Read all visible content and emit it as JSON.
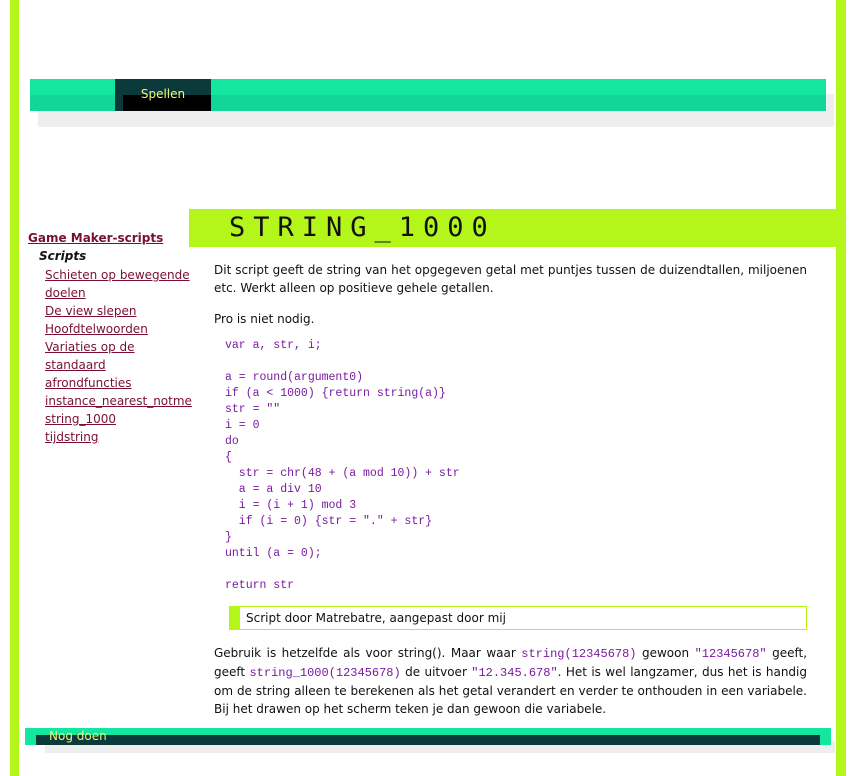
{
  "nav": {
    "tab_label": "Spellen"
  },
  "title": "STRING_1000",
  "sidebar": {
    "title": "Game Maker-scripts",
    "subtitle": "Scripts",
    "links": [
      "Schieten op bewegende doelen",
      "De view slepen",
      "Hoofdtelwoorden",
      "Variaties op de standaard",
      "afrondfuncties",
      "instance_nearest_notme",
      "string_1000",
      "tijdstring"
    ]
  },
  "content": {
    "p1": "Dit script geeft de string van het opgegeven getal met puntjes tussen de duizendtallen, miljoenen etc. Werkt alleen op positieve gehele getallen.",
    "p2": "Pro is niet nodig.",
    "code": "var a, str, i;\n\na = round(argument0)\nif (a < 1000) {return string(a)}\nstr = \"\"\ni = 0\ndo\n{\n  str = chr(48 + (a mod 10)) + str\n  a = a div 10\n  i = (i + 1) mod 3\n  if (i = 0) {str = \".\" + str}\n}\nuntil (a = 0);\n\nreturn str",
    "credit": "Script door Matrebatre, aangepast door mij",
    "p3_parts": {
      "t1": "Gebruik is hetzelfde als voor string(). Maar waar ",
      "c1": "string(12345678)",
      "t2": " gewoon ",
      "c2": "\"12345678\"",
      "t3": " geeft, geeft ",
      "c3": "string_1000(12345678)",
      "t4": " de uitvoer ",
      "c4": "\"12.345.678\"",
      "t5": ". Het is wel langzamer, dus het is handig om de string alleen te berekenen als het getal verandert en verder te onthouden in een variabele. Bij het drawen op het scherm teken je dan gewoon die variabele."
    }
  },
  "footer": {
    "label": "Nog doen"
  },
  "colors": {
    "frame": "#b4f51a",
    "nav": "#14e6a0",
    "dark": "#0c3a3a",
    "link": "#7a1030",
    "code": "#7a1aa0"
  }
}
